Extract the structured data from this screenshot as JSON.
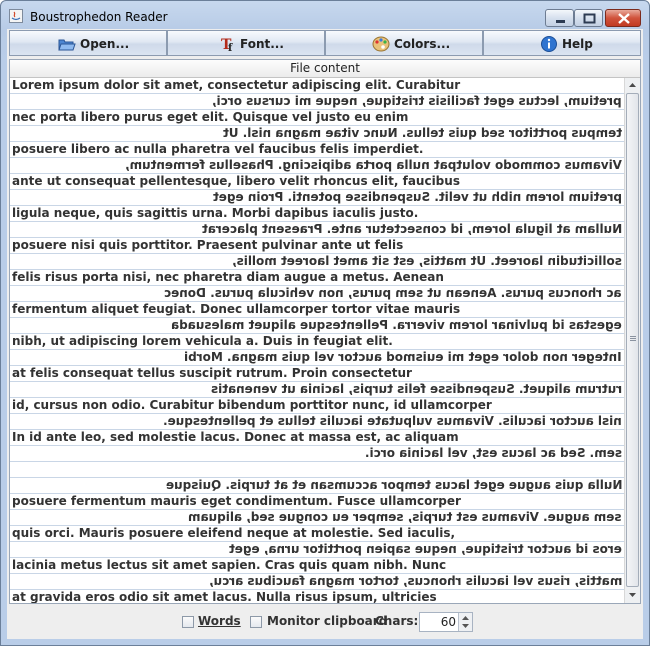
{
  "window": {
    "title": "Boustrophedon Reader",
    "icon": "java-app-icon"
  },
  "toolbar": {
    "open_label": "Open...",
    "font_label": "Font...",
    "colors_label": "Colors...",
    "help_label": "Help"
  },
  "table": {
    "header": "File content",
    "rows": [
      {
        "text": "Lorem ipsum dolor sit amet, consectetur adipiscing elit. Curabitur",
        "reversed": false
      },
      {
        "text": "pretium, lectus eget facilisis tristique, neque mi cursus orci,",
        "reversed": true
      },
      {
        "text": "nec porta libero purus eget elit. Quisque vel justo eu enim",
        "reversed": false
      },
      {
        "text": "tempus porttitor sed quis tellus. Nunc vitae magna nisl. Ut",
        "reversed": true
      },
      {
        "text": "posuere libero ac nulla pharetra vel faucibus felis imperdiet.",
        "reversed": false
      },
      {
        "text": "Vivamus commodo volutpat nulla porta adipiscing. Phasellus fermentum,",
        "reversed": true
      },
      {
        "text": "ante ut consequat pellentesque, libero velit rhoncus elit, faucibus",
        "reversed": false
      },
      {
        "text": "pretium lorem nibh ut velit. Suspendisse potenti. Proin eget",
        "reversed": true
      },
      {
        "text": "ligula neque, quis sagittis urna. Morbi dapibus iaculis justo.",
        "reversed": false
      },
      {
        "text": "Nullam at ligula lorem, id consectetur ante. Praesent placerat",
        "reversed": true
      },
      {
        "text": "posuere nisi quis porttitor. Praesent pulvinar ante ut felis",
        "reversed": false
      },
      {
        "text": "sollicitudin laoreet. Ut mattis, est sit amet laoreet mollis,",
        "reversed": true
      },
      {
        "text": "felis risus porta nisi, nec pharetra diam augue a metus. Aenean",
        "reversed": false
      },
      {
        "text": "ac rhoncus purus. Aenean ut sem purus, non vehicula purus. Donec",
        "reversed": true
      },
      {
        "text": "fermentum aliquet feugiat. Donec ullamcorper tortor vitae mauris",
        "reversed": false
      },
      {
        "text": "egestas id pulvinar lorem viverra. Pellentesque aliquet malesuada",
        "reversed": true
      },
      {
        "text": "nibh, ut adipiscing lorem vehicula a. Duis in feugiat elit.",
        "reversed": false
      },
      {
        "text": "Integer non dolor eget mi euismod auctor vel quis magna. Morbi",
        "reversed": true
      },
      {
        "text": "at felis consequat tellus suscipit rutrum. Proin consectetur",
        "reversed": false
      },
      {
        "text": "rutrum aliquet. Suspendisse felis turpis, lacinia ut venenatis",
        "reversed": true
      },
      {
        "text": "id, cursus non odio. Curabitur bibendum porttitor nunc, id ullamcorper",
        "reversed": false
      },
      {
        "text": "nisl auctor iaculis. Vivamus vulputate iaculis tellus et pellentesque.",
        "reversed": true
      },
      {
        "text": "In id ante leo, sed molestie lacus. Donec at massa est, ac aliquam",
        "reversed": false
      },
      {
        "text": "sem. Sed ac lacus est, vel lacinia orci.",
        "reversed": true
      },
      {
        "text": "",
        "reversed": false
      },
      {
        "text": "Nulla quis augue eget lacus tempor accumsan et at turpis. Quisque",
        "reversed": true
      },
      {
        "text": "posuere fermentum mauris eget condimentum. Fusce ullamcorper",
        "reversed": false
      },
      {
        "text": "sem augue. Vivamus est turpis, semper eu congue sed, aliquam",
        "reversed": true
      },
      {
        "text": "quis orci. Mauris posuere eleifend neque at molestie. Sed iaculis,",
        "reversed": false
      },
      {
        "text": "eros id auctor tristique, neque sapien porttitor urna, eget",
        "reversed": true
      },
      {
        "text": "lacinia metus lectus sit amet sapien. Cras quis quam nibh. Nunc",
        "reversed": false
      },
      {
        "text": "mattis, risus vel iaculis rhoncus, tortor magna faucibus arcu,",
        "reversed": true
      },
      {
        "text": "at gravida eros odio sit amet lacus. Nulla risus ipsum, ultricies",
        "reversed": false
      }
    ]
  },
  "status": {
    "words_label": "Words",
    "words_checked": false,
    "monitor_label": "Monitor clipboard",
    "monitor_checked": false,
    "chars_label": "Chars:",
    "chars_value": "60"
  }
}
